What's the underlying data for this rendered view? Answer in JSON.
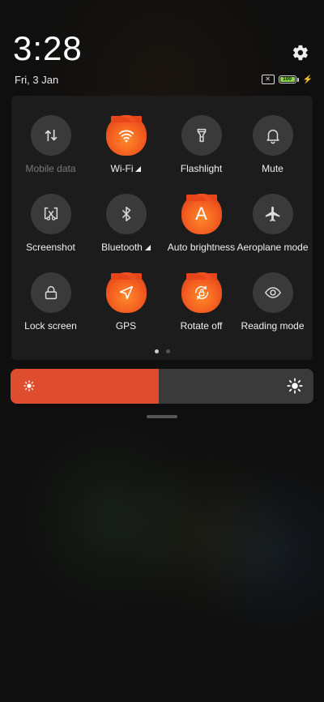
{
  "status_bar": {
    "time": "3:28",
    "date": "Fri, 3 Jan",
    "battery_level": "100",
    "battery_color": "#8ad34b",
    "sim_icon": "no-sim-icon",
    "charging_icon": "charging-bolt-icon"
  },
  "settings_icon": "gear-icon",
  "tiles": [
    {
      "label": "Mobile data",
      "active": false,
      "icon": "mobile-data-arrows-icon"
    },
    {
      "label": "Wi-Fi",
      "active": true,
      "icon": "wifi-icon"
    },
    {
      "label": "Flashlight",
      "active": false,
      "icon": "flashlight-icon"
    },
    {
      "label": "Mute",
      "active": false,
      "icon": "bell-icon"
    },
    {
      "label": "Screenshot",
      "active": false,
      "icon": "screenshot-scissors-icon"
    },
    {
      "label": "Bluetooth",
      "active": false,
      "icon": "bluetooth-icon"
    },
    {
      "label": "Auto brightness",
      "active": true,
      "icon": "auto-brightness-a-icon",
      "glyph": "A"
    },
    {
      "label": "Aeroplane mode",
      "active": false,
      "icon": "airplane-icon"
    },
    {
      "label": "Lock screen",
      "active": false,
      "icon": "lock-icon"
    },
    {
      "label": "GPS",
      "active": true,
      "icon": "location-arrow-icon"
    },
    {
      "label": "Rotate off",
      "active": true,
      "icon": "rotation-lock-icon"
    },
    {
      "label": "Reading mode",
      "active": false,
      "icon": "eye-icon"
    }
  ],
  "pager": {
    "pages": 2,
    "current": 1
  },
  "brightness": {
    "level_percent": 49,
    "accent_color": "#de4d2e",
    "low_icon": "sun-small-icon",
    "high_icon": "sun-large-icon"
  }
}
